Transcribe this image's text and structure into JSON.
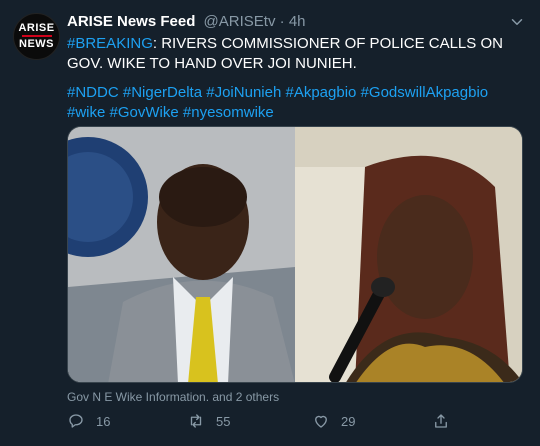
{
  "account": {
    "avatar_line1": "ARISE",
    "avatar_line2": "NEWS",
    "display_name": "ARISE News Feed",
    "handle": "@ARISEtv",
    "separator": "·",
    "time": "4h"
  },
  "tweet": {
    "breaking_tag": "#BREAKING",
    "headline": ": RIVERS COMMISSIONER OF POLICE CALLS ON GOV. WIKE TO HAND OVER JOI NUNIEH.",
    "hashtags": [
      "#NDDC",
      "#NigerDelta",
      "#JoiNunieh",
      "#Akpagbio",
      "#GodswillAkpagbio",
      "#wike",
      "#GovWike",
      "#nyesomwike"
    ]
  },
  "media": {
    "attribution": "Gov N E Wike Information. and 2 others"
  },
  "actions": {
    "replies": "16",
    "retweets": "55",
    "likes": "29"
  },
  "colors": {
    "background": "#15202b",
    "link": "#1da1f2",
    "muted": "#8899a6"
  }
}
